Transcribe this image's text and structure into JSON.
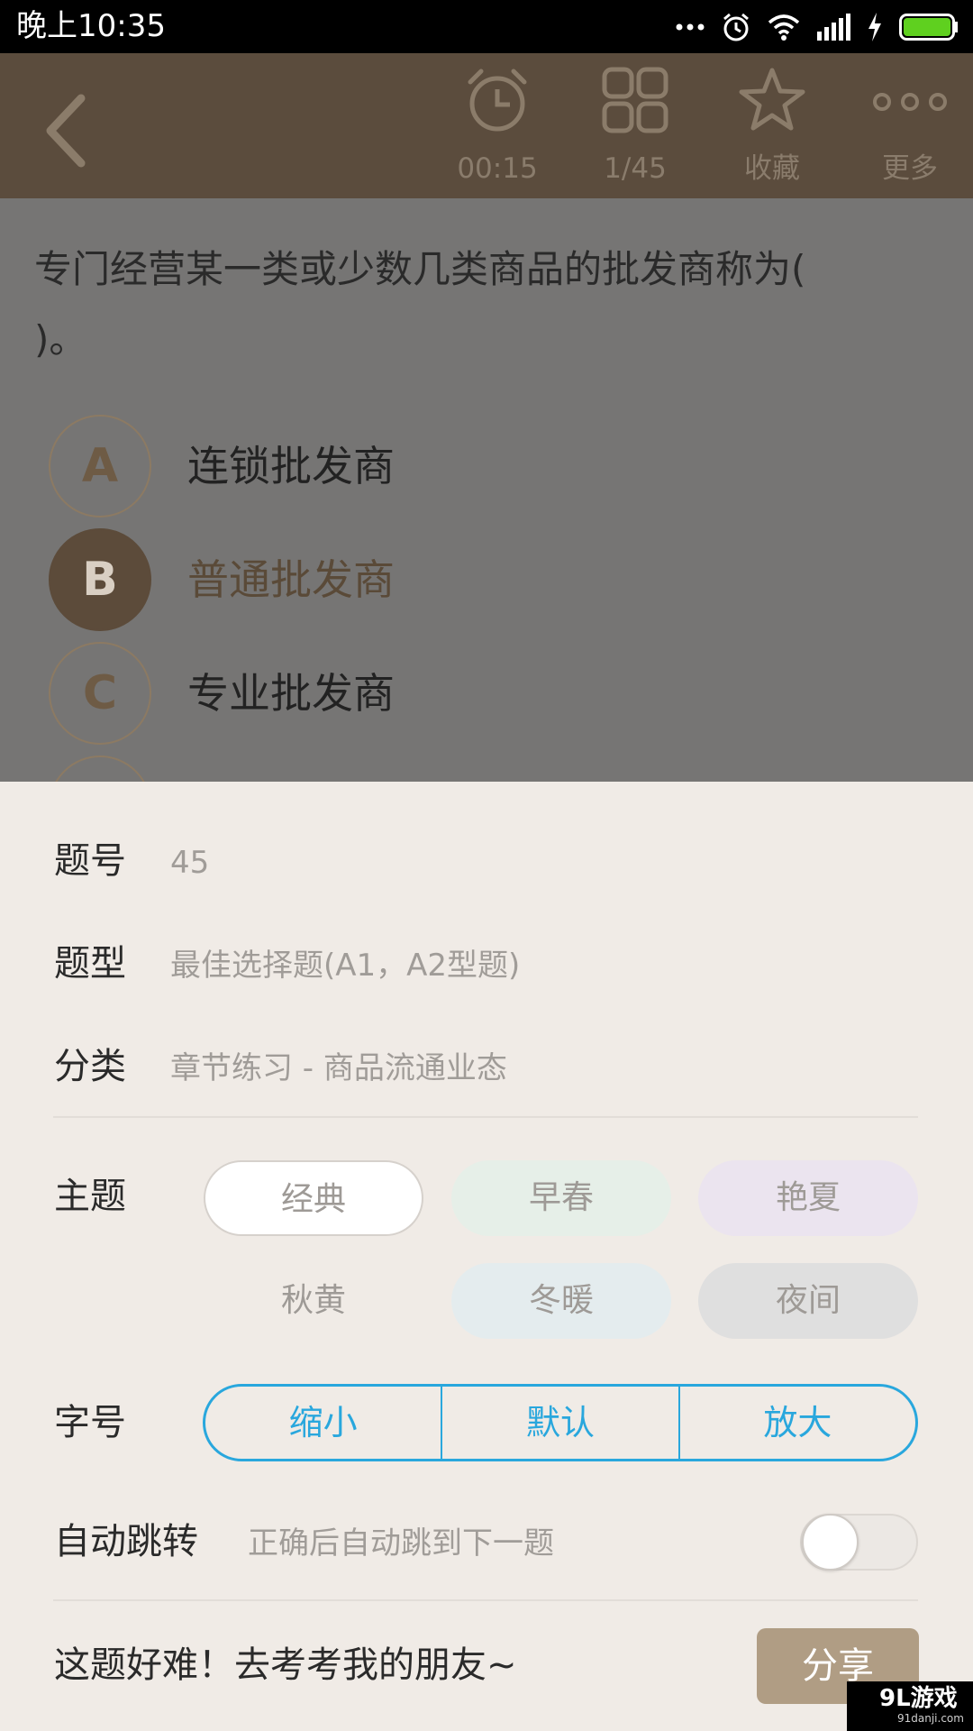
{
  "status_bar": {
    "time": "晚上10:35"
  },
  "toolbar": {
    "timer": "00:15",
    "progress": "1/45",
    "favorite": "收藏",
    "more": "更多"
  },
  "question": {
    "line1": "专门经营某一类或少数几类商品的批发商称为(",
    "line2": ")。",
    "options": [
      {
        "letter": "A",
        "text": "连锁批发商",
        "selected": false
      },
      {
        "letter": "B",
        "text": "普通批发商",
        "selected": true
      },
      {
        "letter": "C",
        "text": "专业批发商",
        "selected": false
      }
    ]
  },
  "sheet": {
    "number_label": "题号",
    "number_value": "45",
    "type_label": "题型",
    "type_value": "最佳选择题(A1，A2型题)",
    "category_label": "分类",
    "category_value": "章节练习 - 商品流通业态",
    "theme_label": "主题",
    "themes": [
      {
        "label": "经典",
        "color": "#ffffff"
      },
      {
        "label": "早春",
        "color": "#e6efe8"
      },
      {
        "label": "艳夏",
        "color": "#ebe4ef"
      },
      {
        "label": "秋黄",
        "color": "#f0ebe6"
      },
      {
        "label": "冬暖",
        "color": "#e4ecee"
      },
      {
        "label": "夜间",
        "color": "#dfdfdf"
      }
    ],
    "font_label": "字号",
    "font_options": [
      "缩小",
      "默认",
      "放大"
    ],
    "auto_label": "自动跳转",
    "auto_desc": "正确后自动跳到下一题",
    "auto_enabled": false,
    "share_text": "这题好难！去考考我的朋友~",
    "share_button": "分享"
  },
  "watermark": {
    "brand": "9L游戏",
    "url": "91danji.com"
  },
  "colors": {
    "toolbar": "#5b4c3d",
    "accent": "#29a7dd",
    "share": "#b09d84"
  }
}
